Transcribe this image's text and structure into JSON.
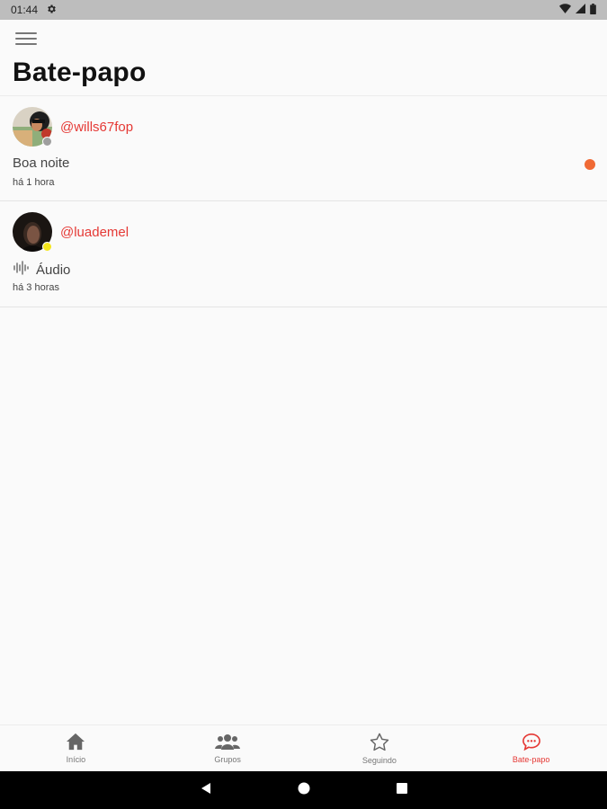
{
  "status_bar": {
    "time": "01:44",
    "icons": [
      "settings-gear-icon",
      "wifi-icon",
      "signal-icon",
      "battery-icon"
    ]
  },
  "header": {
    "menu_icon": "hamburger-menu-icon",
    "title": "Bate-papo"
  },
  "chats": [
    {
      "username": "@wills67fop",
      "message": "Boa noite",
      "time": "há 1 hora",
      "presence_color": "#9e9e9e",
      "unread": true
    },
    {
      "username": "@luademel",
      "message": "Áudio",
      "message_icon": "audio-wave-icon",
      "time": "há 3 horas",
      "presence_color": "#f4e51c",
      "unread": false
    }
  ],
  "bottom_nav": {
    "items": [
      {
        "label": "Início",
        "icon": "home-icon",
        "active": false
      },
      {
        "label": "Grupos",
        "icon": "group-icon",
        "active": false
      },
      {
        "label": "Seguindo",
        "icon": "star-icon",
        "active": false
      },
      {
        "label": "Bate-papo",
        "icon": "chat-bubble-icon",
        "active": true
      }
    ]
  },
  "colors": {
    "accent": "#e53935",
    "unread_dot": "#f06a35",
    "background": "#fafafa"
  }
}
